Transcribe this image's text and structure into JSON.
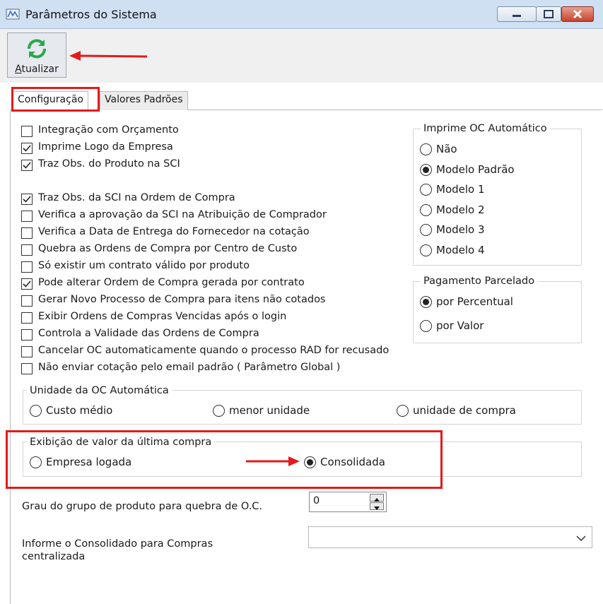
{
  "window": {
    "title": "Parâmetros do Sistema",
    "icon": "app-window-icon"
  },
  "toolbar": {
    "refresh_label_u": "A",
    "refresh_label_rest": "tualizar",
    "refresh_icon": "refresh-icon"
  },
  "tabs": [
    {
      "label": "Configuração",
      "active": true
    },
    {
      "label": "Valores Padrões",
      "active": false
    }
  ],
  "options": [
    {
      "label": "Integração com Orçamento",
      "checked": false
    },
    {
      "label": "Imprime Logo da Empresa",
      "checked": true
    },
    {
      "label": "Traz Obs. do Produto na SCI",
      "checked": true
    },
    {
      "label": "Traz Obs. da SCI na Ordem de Compra",
      "checked": true
    },
    {
      "label": "Verifica a aprovação da SCI na Atribuição de Comprador",
      "checked": false
    },
    {
      "label": "Verifica a Data de Entrega do Fornecedor na cotação",
      "checked": false
    },
    {
      "label": "Quebra as Ordens de Compra por Centro de Custo",
      "checked": false
    },
    {
      "label": "Só existir um contrato válido por produto",
      "checked": false
    },
    {
      "label": "Pode alterar Ordem de Compra gerada por contrato",
      "checked": true
    },
    {
      "label": "Gerar Novo Processo de Compra para itens não cotados",
      "checked": false
    },
    {
      "label": "Exibir Ordens de Compras Vencidas após o login",
      "checked": false
    },
    {
      "label": "Controla a Validade das Ordens de Compra",
      "checked": false
    },
    {
      "label": "Cancelar OC automaticamente quando o processo RAD for recusado",
      "checked": false
    },
    {
      "label": "Não enviar cotação pelo email padrão ( Parâmetro Global )",
      "checked": false
    }
  ],
  "imprime_oc": {
    "title": "Imprime OC Automático",
    "options": [
      {
        "label": "Não",
        "selected": false
      },
      {
        "label": "Modelo Padrão",
        "selected": true
      },
      {
        "label": "Modelo 1",
        "selected": false
      },
      {
        "label": "Modelo 2",
        "selected": false
      },
      {
        "label": "Modelo 3",
        "selected": false
      },
      {
        "label": "Modelo 4",
        "selected": false
      }
    ]
  },
  "pagamento": {
    "title": "Pagamento Parcelado",
    "options": [
      {
        "label": "por Percentual",
        "selected": true
      },
      {
        "label": "por Valor",
        "selected": false
      }
    ]
  },
  "unidade": {
    "title": "Unidade da OC Automática",
    "options": [
      {
        "label": "Custo médio",
        "selected": false
      },
      {
        "label": "menor unidade",
        "selected": false
      },
      {
        "label": "unidade de compra",
        "selected": false
      }
    ]
  },
  "exibicao": {
    "title": "Exibição de valor da última compra",
    "options": [
      {
        "label": "Empresa logada",
        "selected": false
      },
      {
        "label": "Consolidada",
        "selected": true
      }
    ]
  },
  "grau": {
    "label": "Grau do grupo de produto para quebra de O.C.",
    "value": "0"
  },
  "consolidado": {
    "label_line1": "Informe o Consolidado para Compras",
    "label_line2": "centralizada",
    "value": ""
  },
  "colors": {
    "highlight": "#e21b1b",
    "titlebar": "#cfe0f3",
    "refresh_icon": "#2aa84a"
  }
}
